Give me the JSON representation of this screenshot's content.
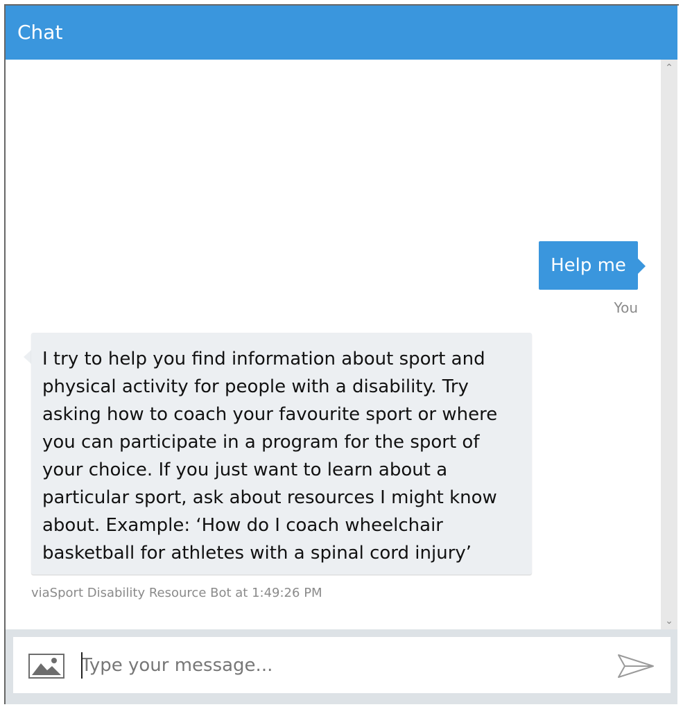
{
  "header": {
    "title": "Chat"
  },
  "messages": [
    {
      "from": "user",
      "text": "Help me",
      "sender_label": "You"
    },
    {
      "from": "bot",
      "text": "I try to help you find information about sport and physical activity for people with a disability. Try asking how to coach your favourite sport or where you can participate in a program for the sport of your choice. If you just want to learn about a particular sport, ask about resources I might know about. Example: ‘How do I coach wheelchair basketball for athletes with a spinal cord injury’",
      "sender_label": "viaSport Disability Resource Bot at 1:49:26 PM"
    }
  ],
  "input": {
    "placeholder": "Type your message..."
  },
  "icons": {
    "upload": "image-upload-icon",
    "send": "send-icon",
    "scroll_up": "chevron-up-icon",
    "scroll_down": "chevron-down-icon"
  },
  "colors": {
    "accent": "#3a96dd",
    "bot_bubble": "#eceff2",
    "input_area": "#dde2e6"
  }
}
